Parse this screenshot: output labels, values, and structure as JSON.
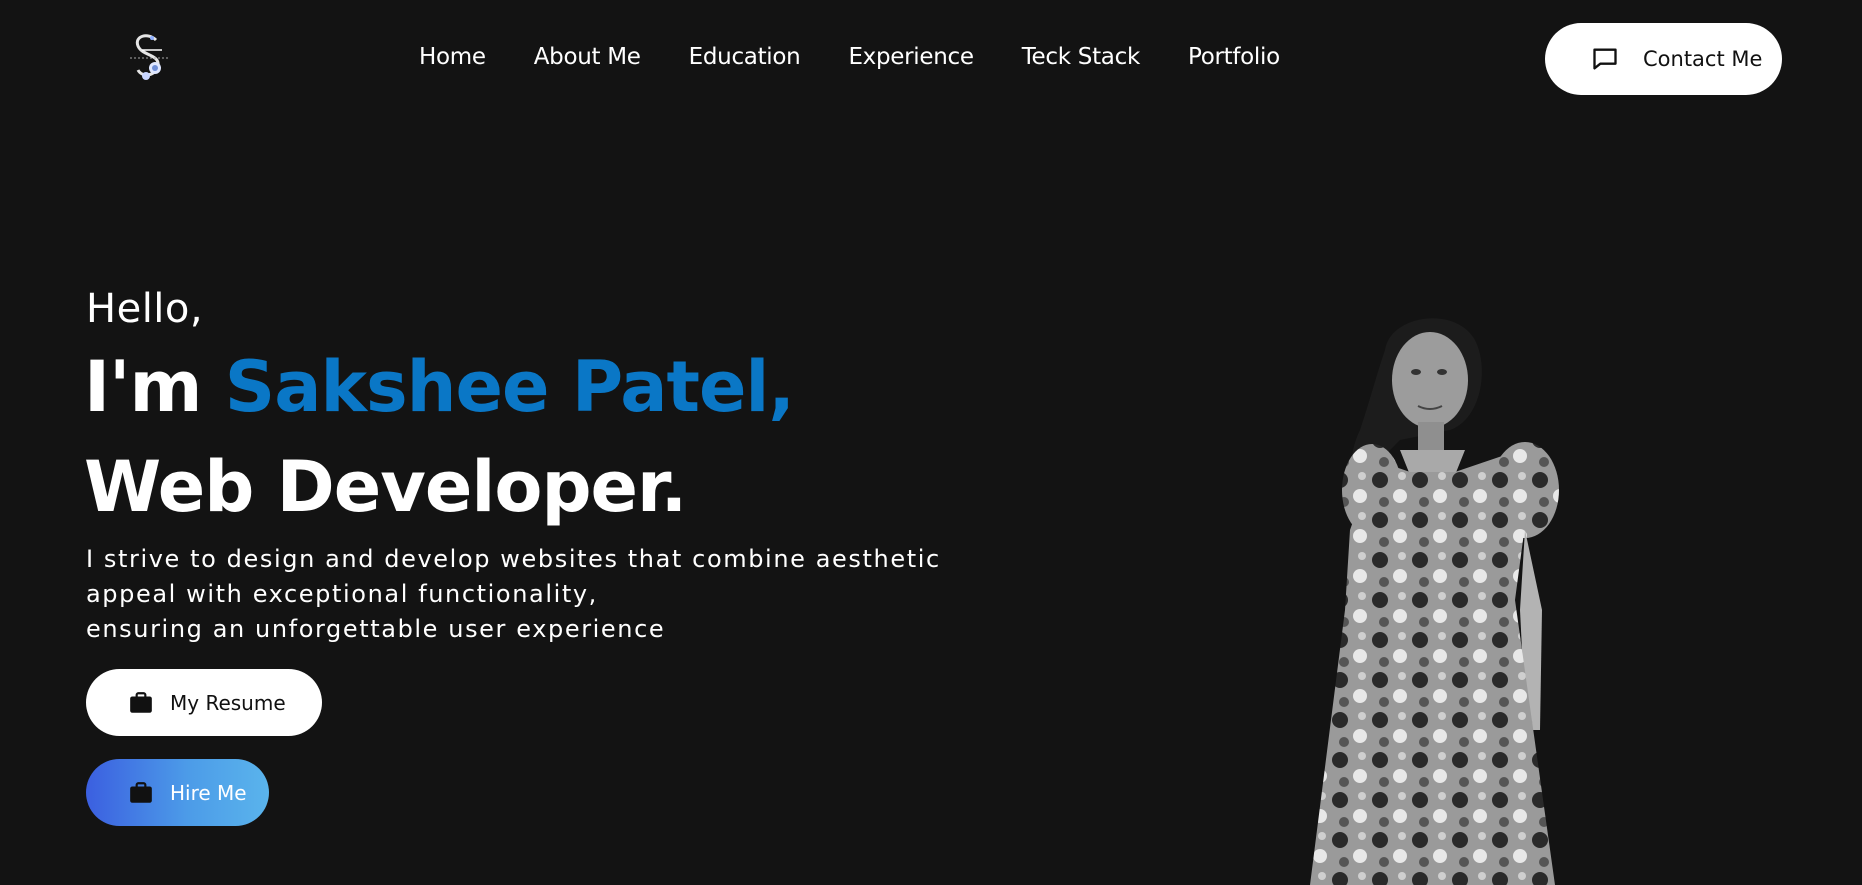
{
  "nav": {
    "logo": "logo-icon",
    "links": [
      "Home",
      "About Me",
      "Education",
      "Experience",
      "Teck Stack",
      "Portfolio"
    ],
    "contact_label": "Contact Me",
    "contact_icon": "message-square-icon"
  },
  "hero": {
    "greeting": "Hello,",
    "intro_prefix": "I'm",
    "name": "Sakshee Patel,",
    "role": "Web Developer.",
    "description_lines": [
      "I strive to design and develop websites that combine aesthetic",
      "appeal with exceptional functionality,",
      "ensuring an unforgettable user experience"
    ],
    "resume_label": "My Resume",
    "hire_label": "Hire Me",
    "button_icon": "briefcase-icon"
  },
  "colors": {
    "background": "#131313",
    "accent": "#0a77c6",
    "hire_gradient_start": "#3b5fe0",
    "hire_gradient_end": "#5ab4ec"
  }
}
